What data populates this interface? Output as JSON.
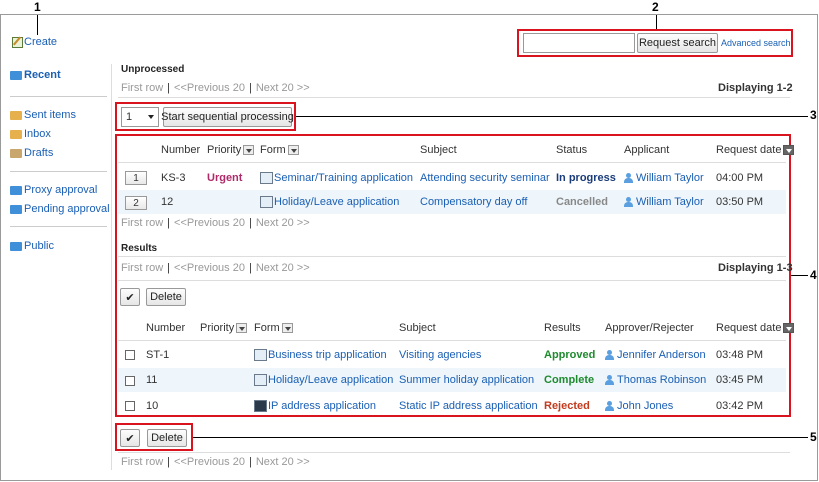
{
  "callouts": [
    "1",
    "2",
    "3",
    "4",
    "5"
  ],
  "create_label": "Create",
  "search": {
    "placeholder": "",
    "button": "Request search",
    "advanced": "Advanced search"
  },
  "sidebar": {
    "items": [
      {
        "label": "Recent",
        "icon": "folder-blue-icon",
        "active": true
      },
      {
        "label": "Sent items",
        "icon": "folder-yellow-icon"
      },
      {
        "label": "Inbox",
        "icon": "folder-yellow-icon"
      },
      {
        "label": "Drafts",
        "icon": "folder-tan-icon"
      },
      {
        "label": "Proxy approval",
        "icon": "folder-blue-icon"
      },
      {
        "label": "Pending approval",
        "icon": "folder-blue-icon"
      },
      {
        "label": "Public",
        "icon": "folder-blue-icon"
      }
    ]
  },
  "pager": {
    "first": "First row",
    "prev": "<<Previous 20",
    "next": "Next 20 >>",
    "sep": "|"
  },
  "unprocessed": {
    "title": "Unprocessed",
    "displaying": "Displaying 1-2",
    "select_value": "1",
    "start_button": "Start sequential processing",
    "headers": [
      "Number",
      "Priority",
      "Form",
      "Subject",
      "Status",
      "Applicant",
      "Request date"
    ],
    "rows": [
      {
        "idx": "1",
        "number": "KS-3",
        "priority": "Urgent",
        "form": "Seminar/Training application",
        "subject": "Attending security seminar",
        "status": "In progress",
        "applicant": "William Taylor",
        "date": "04:00 PM"
      },
      {
        "idx": "2",
        "number": "12",
        "priority": "",
        "form": "Holiday/Leave application",
        "subject": "Compensatory day off",
        "status": "Cancelled",
        "applicant": "William Taylor",
        "date": "03:50 PM"
      }
    ]
  },
  "results": {
    "title": "Results",
    "displaying": "Displaying 1-3",
    "check_label": "✔",
    "delete_label": "Delete",
    "headers": [
      "Number",
      "Priority",
      "Form",
      "Subject",
      "Results",
      "Approver/Rejecter",
      "Request date"
    ],
    "rows": [
      {
        "number": "ST-1",
        "priority": "",
        "form": "Business trip application",
        "subject": "Visiting agencies",
        "result": "Approved",
        "approver": "Jennifer Anderson",
        "date": "03:48 PM"
      },
      {
        "number": "11",
        "priority": "",
        "form": "Holiday/Leave application",
        "subject": "Summer holiday application",
        "result": "Complete",
        "approver": "Thomas Robinson",
        "date": "03:45 PM"
      },
      {
        "number": "10",
        "priority": "",
        "form": "IP address application",
        "subject": "Static IP address application",
        "result": "Rejected",
        "approver": "John Jones",
        "date": "03:42 PM"
      }
    ]
  },
  "colors": {
    "highlight": "#d9141f",
    "link": "#1a5fb4",
    "approved": "#1e8a2e",
    "rejected": "#c23b1e",
    "in_progress": "#1a3c7a",
    "urgent": "#b02a6a"
  }
}
